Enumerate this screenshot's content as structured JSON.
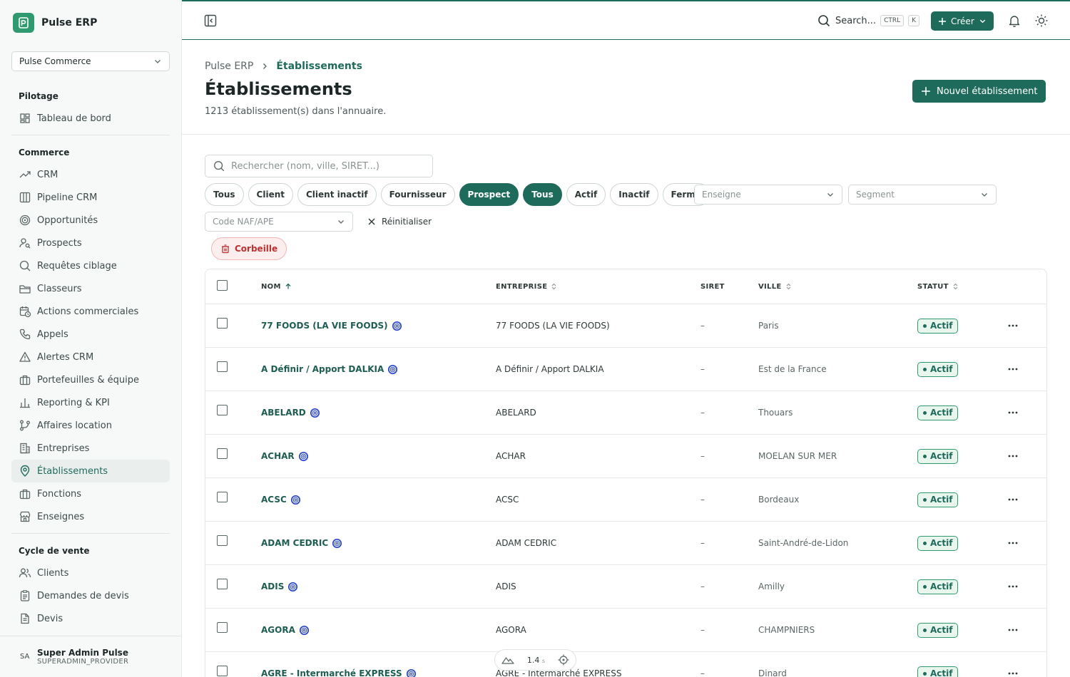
{
  "app": {
    "name": "Pulse ERP",
    "org": "Pulse Commerce"
  },
  "sidebar": {
    "sections": [
      {
        "title": "Pilotage",
        "items": [
          {
            "label": "Tableau de bord",
            "icon": "dashboard-icon"
          }
        ]
      },
      {
        "title": "Commerce",
        "items": [
          {
            "label": "CRM",
            "icon": "trend-icon"
          },
          {
            "label": "Pipeline CRM",
            "icon": "columns-icon"
          },
          {
            "label": "Opportunités",
            "icon": "target-icon"
          },
          {
            "label": "Prospects",
            "icon": "user-search-icon"
          },
          {
            "label": "Requêtes ciblage",
            "icon": "search-icon"
          },
          {
            "label": "Classeurs",
            "icon": "folder-icon"
          },
          {
            "label": "Actions commerciales",
            "icon": "calendar-clock-icon"
          },
          {
            "label": "Appels",
            "icon": "phone-icon"
          },
          {
            "label": "Alertes CRM",
            "icon": "alert-icon"
          },
          {
            "label": "Portefeuilles & équipe",
            "icon": "briefcase-icon"
          },
          {
            "label": "Reporting & KPI",
            "icon": "bar-chart-icon"
          },
          {
            "label": "Affaires location",
            "icon": "branch-icon"
          },
          {
            "label": "Entreprises",
            "icon": "building-icon"
          },
          {
            "label": "Établissements",
            "icon": "map-pin-icon",
            "active": true
          },
          {
            "label": "Fonctions",
            "icon": "briefcase-icon"
          },
          {
            "label": "Enseignes",
            "icon": "store-icon"
          }
        ]
      },
      {
        "title": "Cycle de vente",
        "items": [
          {
            "label": "Clients",
            "icon": "users-icon"
          },
          {
            "label": "Demandes de devis",
            "icon": "clipboard-icon"
          },
          {
            "label": "Devis",
            "icon": "file-icon"
          }
        ]
      }
    ],
    "user": {
      "initials": "SA",
      "name": "Super Admin Pulse",
      "role": "SUPERADMIN_PROVIDER"
    }
  },
  "topbar": {
    "search_label": "Search...",
    "kbd1": "CTRL",
    "kbd2": "K",
    "create_label": "Créer"
  },
  "header": {
    "breadcrumb_root": "Pulse ERP",
    "breadcrumb_current": "Établissements",
    "title": "Établissements",
    "subtitle": "1213 établissement(s) dans l'annuaire.",
    "new_button": "Nouvel établissement"
  },
  "filters": {
    "search_placeholder": "Rechercher (nom, ville, SIRET...)",
    "chips": [
      {
        "label": "Tous",
        "active": false
      },
      {
        "label": "Client",
        "active": false
      },
      {
        "label": "Client inactif",
        "active": false
      },
      {
        "label": "Fournisseur",
        "active": false
      },
      {
        "label": "Prospect",
        "active": true
      },
      {
        "label": "Tous",
        "active": true
      },
      {
        "label": "Actif",
        "active": false
      },
      {
        "label": "Inactif",
        "active": false
      },
      {
        "label": "Fermé",
        "active": false
      }
    ],
    "enseigne_placeholder": "Enseigne",
    "segment_placeholder": "Segment",
    "naf_placeholder": "Code NAF/APE",
    "reset_label": "Réinitialiser",
    "trash_label": "Corbeille"
  },
  "table": {
    "columns": {
      "nom": "NOM",
      "entreprise": "ENTREPRISE",
      "siret": "SIRET",
      "ville": "VILLE",
      "statut": "STATUT"
    },
    "rows": [
      {
        "nom": "77 FOODS (LA VIE FOODS)",
        "entreprise": "77 FOODS (LA VIE FOODS)",
        "siret": "–",
        "ville": "Paris",
        "statut": "Actif"
      },
      {
        "nom": "A Définir / Apport DALKIA",
        "entreprise": "A Définir / Apport DALKIA",
        "siret": "–",
        "ville": "Est de la France",
        "statut": "Actif"
      },
      {
        "nom": "ABELARD",
        "entreprise": "ABELARD",
        "siret": "–",
        "ville": "Thouars",
        "statut": "Actif"
      },
      {
        "nom": "ACHAR",
        "entreprise": "ACHAR",
        "siret": "–",
        "ville": "MOELAN SUR MER",
        "statut": "Actif"
      },
      {
        "nom": "ACSC",
        "entreprise": "ACSC",
        "siret": "–",
        "ville": "Bordeaux",
        "statut": "Actif"
      },
      {
        "nom": "ADAM CEDRIC",
        "entreprise": "ADAM CEDRIC",
        "siret": "–",
        "ville": "Saint-André-de-Lidon",
        "statut": "Actif"
      },
      {
        "nom": "ADIS",
        "entreprise": "ADIS",
        "siret": "–",
        "ville": "Amilly",
        "statut": "Actif"
      },
      {
        "nom": "AGORA",
        "entreprise": "AGORA",
        "siret": "–",
        "ville": "CHAMPNIERS",
        "statut": "Actif"
      },
      {
        "nom": "AGRE - Intermarché EXPRESS",
        "entreprise": "AGRE - Intermarché EXPRESS",
        "siret": "–",
        "ville": "Dinard",
        "statut": "Actif"
      }
    ]
  },
  "perf": {
    "value": "1.4",
    "unit": "s"
  },
  "colors": {
    "accent": "#1e6b5c",
    "brand": "#2f9a6f",
    "danger": "#c02f2f",
    "prospect_icon": "#2b48c8"
  }
}
